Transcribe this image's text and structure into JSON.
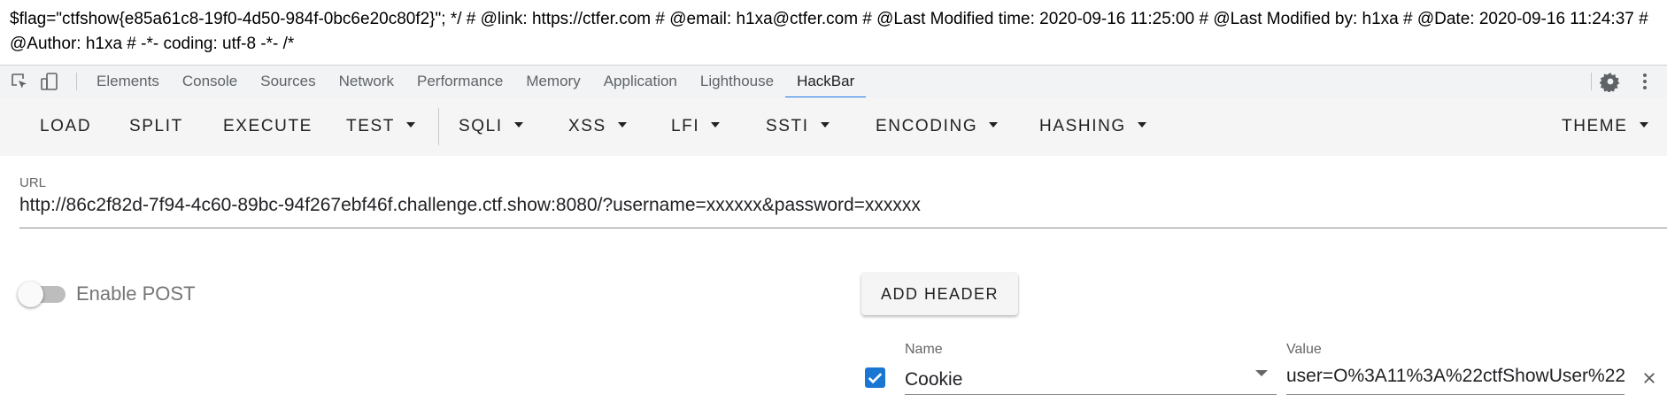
{
  "page": {
    "text": "$flag=\"ctfshow{e85a61c8-19f0-4d50-984f-0bc6e20c80f2}\"; */ # @link: https://ctfer.com # @email: h1xa@ctfer.com # @Last Modified time: 2020-09-16 11:25:00 # @Last Modified by: h1xa # @Date: 2020-09-16 11:24:37 # @Author: h1xa # -*- coding: utf-8 -*- /*"
  },
  "devtools": {
    "tabs": [
      "Elements",
      "Console",
      "Sources",
      "Network",
      "Performance",
      "Memory",
      "Application",
      "Lighthouse",
      "HackBar"
    ],
    "active_tab": "HackBar",
    "icons": [
      "inspect-element-icon",
      "device-toolbar-icon",
      "settings-gear-icon",
      "more-options-icon"
    ]
  },
  "hackbar": {
    "buttons": {
      "load": "LOAD",
      "split": "SPLIT",
      "execute": "EXECUTE",
      "test": "TEST",
      "sqli": "SQLI",
      "xss": "XSS",
      "lfi": "LFI",
      "ssti": "SSTI",
      "encoding": "ENCODING",
      "hashing": "HASHING",
      "theme": "THEME"
    },
    "url": {
      "label": "URL",
      "value": "http://86c2f82d-7f94-4c60-89bc-94f267ebf46f.challenge.ctf.show:8080/?username=xxxxxx&password=xxxxxx"
    },
    "post": {
      "label": "Enable POST",
      "enabled": false
    },
    "add_header": "ADD HEADER",
    "header_row": {
      "checked": true,
      "name_label": "Name",
      "name_value": "Cookie",
      "value_label": "Value",
      "value_value": "user=O%3A11%3A%22ctfShowUser%22"
    }
  },
  "colors": {
    "accent": "#1a73e8",
    "checkbox": "#1976d2",
    "toolbar_bg": "#f5f5f5",
    "devtools_bg": "#f1f3f4"
  }
}
